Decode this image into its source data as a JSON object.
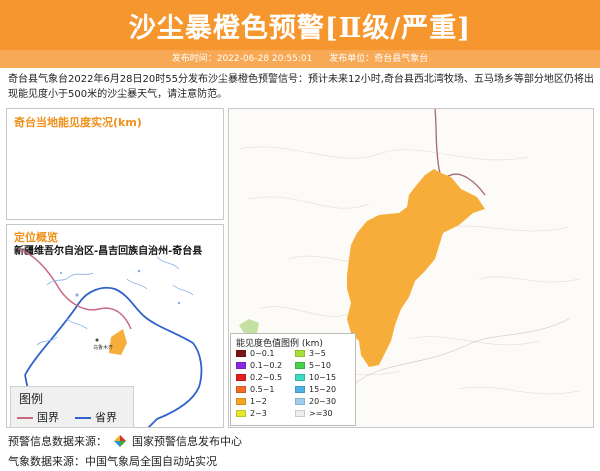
{
  "header": {
    "title": "沙尘暴橙色预警[Ⅱ级/严重]",
    "publish_time_label": "发布时间：2022-06-28 20:55:01",
    "publish_unit_label": "发布单位：奇台县气象台"
  },
  "description": "奇台县气象台2022年6月28日20时55分发布沙尘暴橙色预警信号：预计未来12小时,奇台县西北湾牧场、五马场乡等部分地区仍将出现能见度小于500米的沙尘暴天气，请注意防范。",
  "visibility_panel": {
    "title": "奇台当地能见度实况(km)"
  },
  "location_panel": {
    "title": "定位概览",
    "region": "新疆维吾尔自治区-昌吉回族自治州-奇台县",
    "city_label": "乌鲁木齐"
  },
  "legend": {
    "title": "图例",
    "items": [
      {
        "label": "国界",
        "color": "#c76a82"
      },
      {
        "label": "省界",
        "color": "#2f63c9"
      }
    ]
  },
  "visibility_legend": {
    "title": "能见度色值图例 (km)",
    "left": [
      {
        "label": "0~0.1",
        "color": "#7a1515"
      },
      {
        "label": "0.1~0.2",
        "color": "#8a2be2"
      },
      {
        "label": "0.2~0.5",
        "color": "#e32020"
      },
      {
        "label": "0.5~1",
        "color": "#f46a2b"
      },
      {
        "label": "1~2",
        "color": "#f5a623"
      },
      {
        "label": "2~3",
        "color": "#e6e62e"
      }
    ],
    "right": [
      {
        "label": "3~5",
        "color": "#a8e03a"
      },
      {
        "label": "5~10",
        "color": "#4ad14a"
      },
      {
        "label": "10~15",
        "color": "#3dd9c0"
      },
      {
        "label": "15~20",
        "color": "#4fb3e8"
      },
      {
        "label": "20~30",
        "color": "#9fcfef"
      },
      {
        "label": ">=30",
        "color": "#eeeeee"
      }
    ]
  },
  "warning_area_color": "#f6ad3a",
  "footer": {
    "source_label": "预警信息数据来源：",
    "source_value": "国家预警信息发布中心",
    "weather_label": "气象数据来源：",
    "weather_value": "中国气象局全国自动站实况"
  }
}
